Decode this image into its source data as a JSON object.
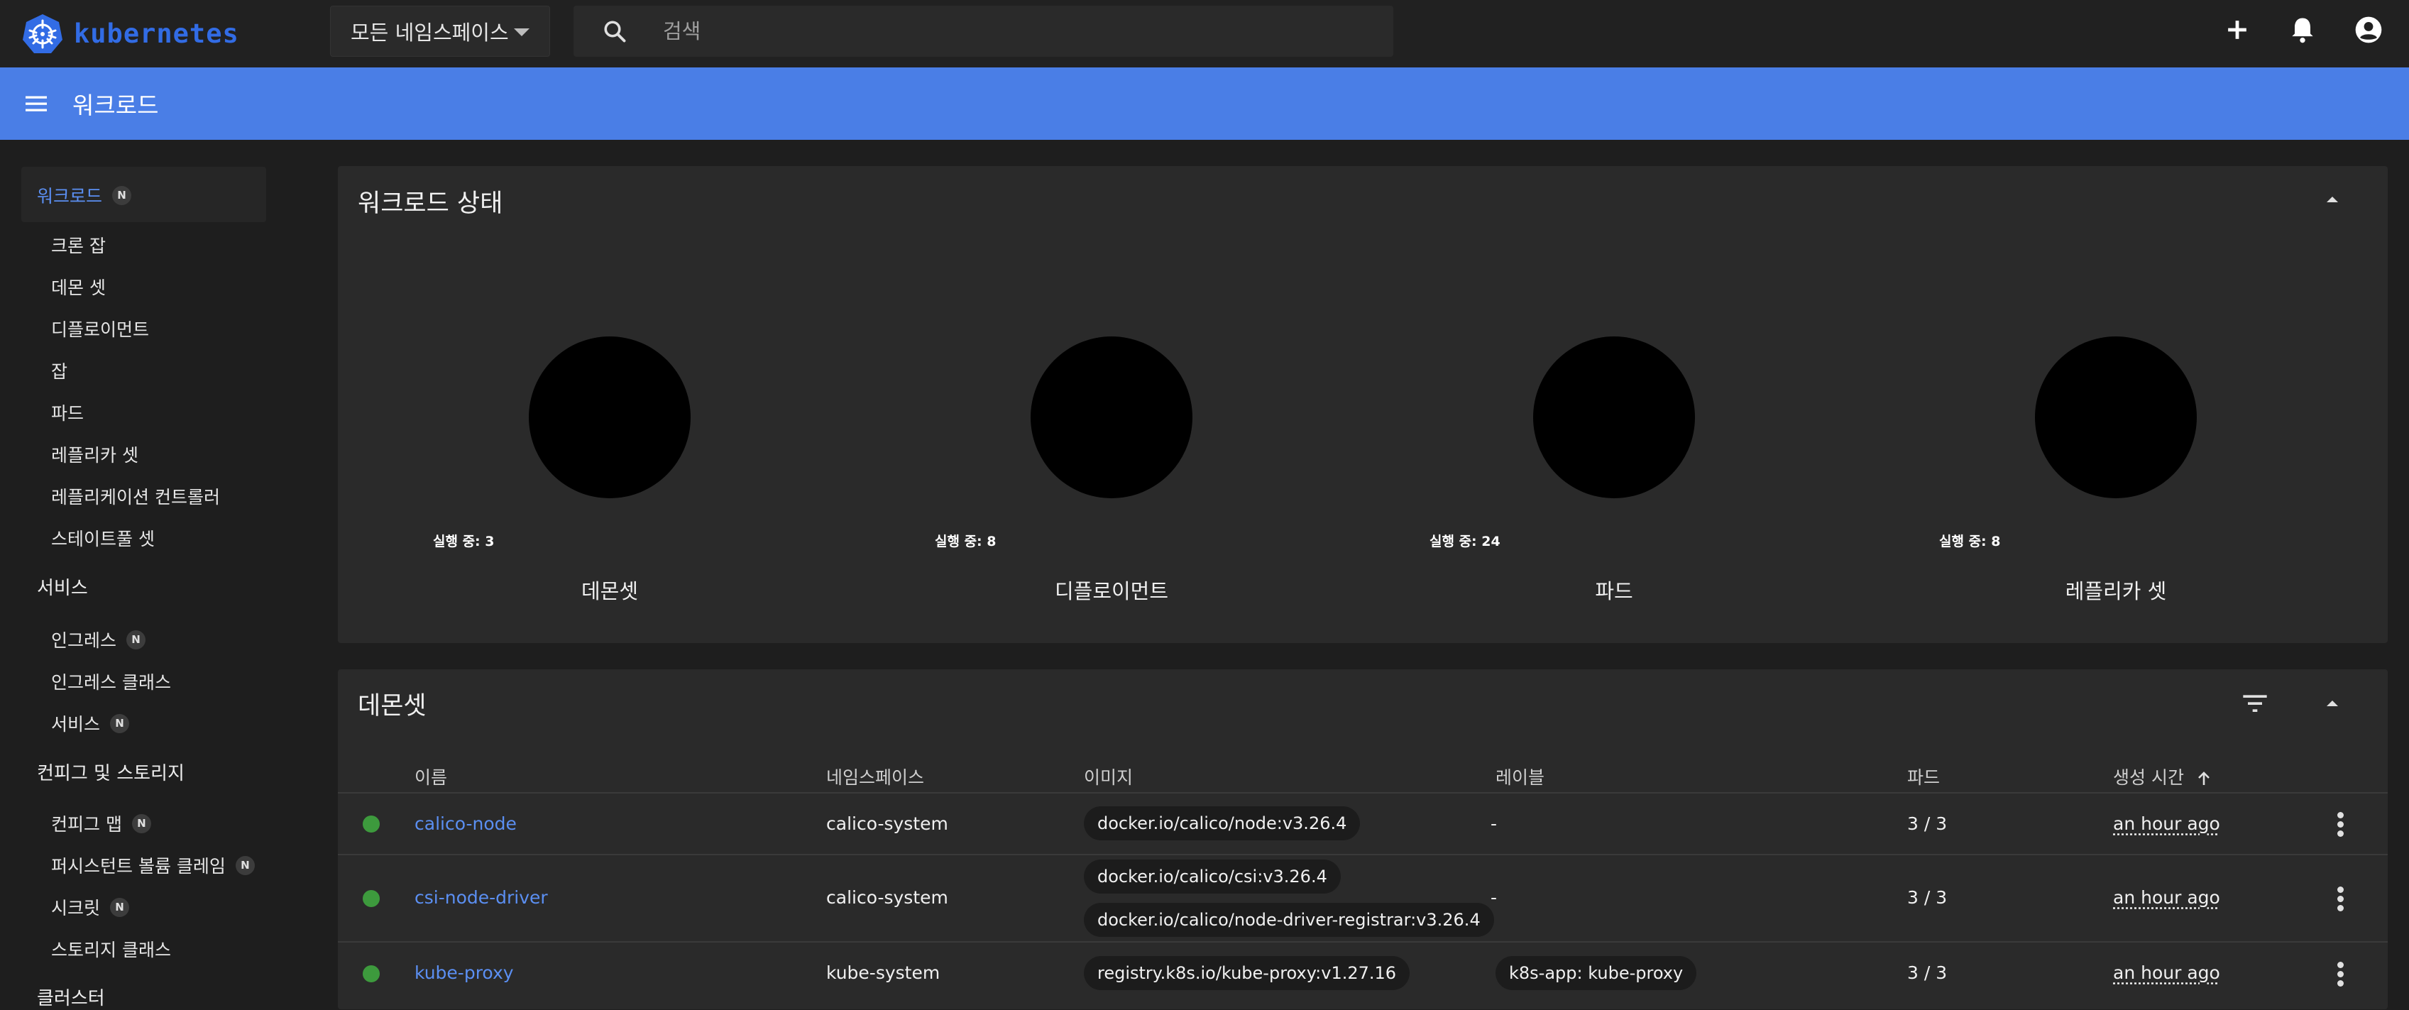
{
  "app": {
    "logo_text": "kubernetes"
  },
  "header": {
    "namespace_select": "모든 네임스페이스",
    "search_placeholder": "검색"
  },
  "titlebar": {
    "title": "워크로드"
  },
  "sidebar": {
    "items": [
      {
        "label": "워크로드",
        "badge": "N",
        "active": true
      },
      {
        "label": "크론 잡"
      },
      {
        "label": "데몬 셋"
      },
      {
        "label": "디플로이먼트"
      },
      {
        "label": "잡"
      },
      {
        "label": "파드"
      },
      {
        "label": "레플리카 셋"
      },
      {
        "label": "레플리케이션 컨트롤러"
      },
      {
        "label": "스테이트풀 셋"
      },
      {
        "label": "서비스",
        "section": true
      },
      {
        "label": "인그레스",
        "badge": "N"
      },
      {
        "label": "인그레스 클래스"
      },
      {
        "label": "서비스",
        "badge": "N"
      },
      {
        "label": "컨피그 및 스토리지",
        "section": true
      },
      {
        "label": "컨피그 맵",
        "badge": "N"
      },
      {
        "label": "퍼시스턴트 볼륨 클레임",
        "badge": "N"
      },
      {
        "label": "시크릿",
        "badge": "N"
      },
      {
        "label": "스토리지 클래스"
      },
      {
        "label": "클러스터",
        "section": true
      }
    ]
  },
  "status_card": {
    "title": "워크로드 상태",
    "charts": [
      {
        "running": "실행 중: 3",
        "title": "데몬셋"
      },
      {
        "running": "실행 중: 8",
        "title": "디플로이먼트"
      },
      {
        "running": "실행 중: 24",
        "title": "파드"
      },
      {
        "running": "실행 중: 8",
        "title": "레플리카 셋"
      }
    ]
  },
  "daemonset_card": {
    "title": "데몬셋",
    "headers": {
      "name": "이름",
      "namespace": "네임스페이스",
      "image": "이미지",
      "labels": "레이블",
      "pods": "파드",
      "created": "생성 시간"
    },
    "rows": [
      {
        "name": "calico-node",
        "namespace": "calico-system",
        "images": [
          "docker.io/calico/node:v3.26.4"
        ],
        "labels": "-",
        "label_chip": "",
        "pods": "3 / 3",
        "created": "an hour ago"
      },
      {
        "name": "csi-node-driver",
        "namespace": "calico-system",
        "images": [
          "docker.io/calico/csi:v3.26.4",
          "docker.io/calico/node-driver-registrar:v3.26.4"
        ],
        "labels": "-",
        "label_chip": "",
        "pods": "3 / 3",
        "created": "an hour ago"
      },
      {
        "name": "kube-proxy",
        "namespace": "kube-system",
        "images": [
          "registry.k8s.io/kube-proxy:v1.27.16"
        ],
        "labels": "",
        "label_chip": "k8s-app: kube-proxy",
        "pods": "3 / 3",
        "created": "an hour ago"
      }
    ]
  },
  "colors": {
    "accent": "#4a7ee6",
    "link": "#5b8ff2",
    "status_ok": "#3d9a3d",
    "logo": "#326ce5"
  }
}
